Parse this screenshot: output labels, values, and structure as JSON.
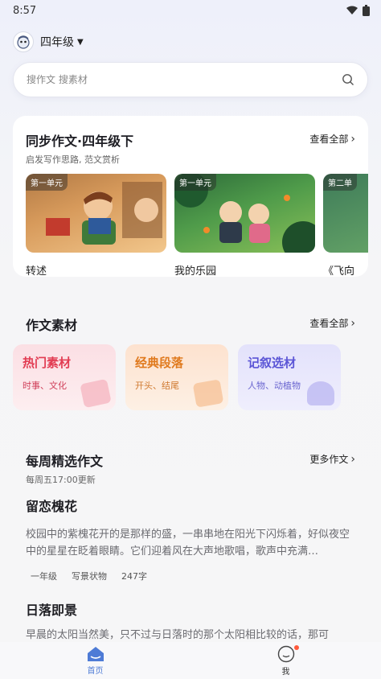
{
  "status_bar": {
    "time": "8:57"
  },
  "header": {
    "grade": "四年级"
  },
  "search": {
    "placeholder": "搜作文 搜素材"
  },
  "sync_section": {
    "title": "同步作文·四年级下",
    "subtitle": "启发写作思路, 范文赏析",
    "see_all": "查看全部",
    "units": [
      {
        "tag": "第一单元",
        "title": "转述"
      },
      {
        "tag": "第一单元",
        "title": "我的乐园"
      },
      {
        "tag": "第二单",
        "title": "《飞向"
      }
    ]
  },
  "material_section": {
    "title": "作文素材",
    "see_all": "查看全部",
    "cards": [
      {
        "title": "热门素材",
        "sub": "时事、文化"
      },
      {
        "title": "经典段落",
        "sub": "开头、结尾"
      },
      {
        "title": "记叙选材",
        "sub": "人物、动植物"
      }
    ]
  },
  "weekly_section": {
    "title": "每周精选作文",
    "subtitle": "每周五17:00更新",
    "more": "更多作文",
    "essays": [
      {
        "title": "留恋槐花",
        "body": "校园中的紫槐花开的是那样的盛，一串串地在阳光下闪烁着，好似夜空中的星星在眨着眼睛。它们迎着风在大声地歌唱，歌声中充满…",
        "grade": "一年级",
        "genre": "写景状物",
        "words": "247字"
      },
      {
        "title": "日落即景",
        "body": "早晨的太阳当然美，只不过与日落时的那个太阳相比较的话，那可"
      }
    ]
  },
  "tab_bar": {
    "home": "首页",
    "me": "我"
  },
  "colors": {
    "accent": "#4e7bd6",
    "hot": "#e23c52",
    "classic": "#e07a1e",
    "narrative": "#5b55d6"
  }
}
